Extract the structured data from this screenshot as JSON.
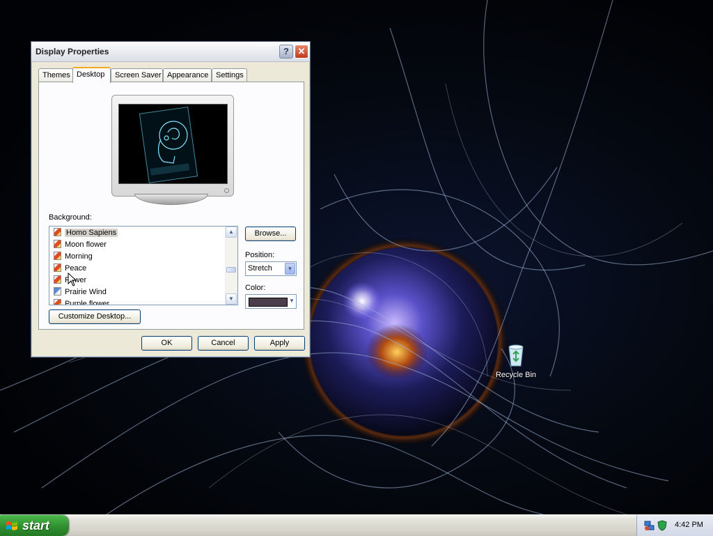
{
  "window": {
    "title": "Display Properties",
    "help_label": "?",
    "close_label": "✕"
  },
  "tabs": [
    {
      "label": "Themes"
    },
    {
      "label": "Desktop",
      "active": true
    },
    {
      "label": "Screen Saver"
    },
    {
      "label": "Appearance"
    },
    {
      "label": "Settings"
    }
  ],
  "desktop_tab": {
    "background_label": "Background:",
    "background_items": [
      {
        "label": "Homo Sapiens",
        "selected": true,
        "icon": "image-icon"
      },
      {
        "label": "Moon flower",
        "icon": "image-icon"
      },
      {
        "label": "Morning",
        "icon": "image-icon"
      },
      {
        "label": "Peace",
        "icon": "image-icon"
      },
      {
        "label": "Power",
        "icon": "image-icon"
      },
      {
        "label": "Prairie Wind",
        "icon": "pencil-image-icon"
      },
      {
        "label": "Purple flower",
        "icon": "image-icon"
      }
    ],
    "browse_label": "Browse...",
    "position_label": "Position:",
    "position_value": "Stretch",
    "color_label": "Color:",
    "color_value": "#4a3f4a",
    "customize_label": "Customize Desktop..."
  },
  "footer": {
    "ok_label": "OK",
    "cancel_label": "Cancel",
    "apply_label": "Apply"
  },
  "desktop": {
    "recycle_bin_label": "Recycle Bin"
  },
  "taskbar": {
    "start_label": "start",
    "clock": "4:42 PM"
  },
  "colors": {
    "taskbar_start": "#2f8f2f",
    "tab_highlight": "#f7a823",
    "button_border": "#003c74",
    "selection": "#d6d3ce"
  }
}
